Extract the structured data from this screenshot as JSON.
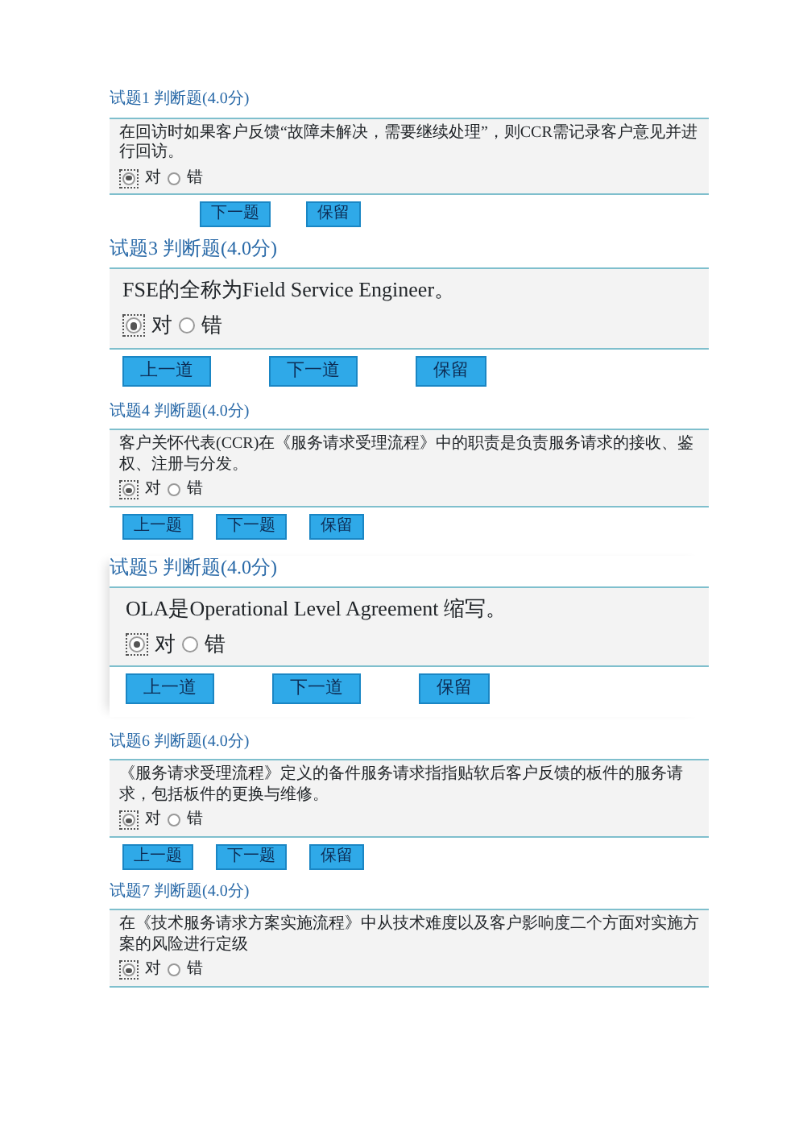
{
  "questions": [
    {
      "title": "试题1 判断题(4.0分)",
      "text": "在回访时如果客户反馈“故障未解决，需要继续处理”，则CCR需记录客户意见并进行回访。",
      "options": [
        {
          "label": "对",
          "selected": true
        },
        {
          "label": "错",
          "selected": false
        }
      ],
      "buttons": [
        "下一题",
        "保留"
      ]
    },
    {
      "title": "试题3 判断题(4.0分)",
      "text": "FSE的全称为Field Service Engineer。",
      "options": [
        {
          "label": "对",
          "selected": true
        },
        {
          "label": "错",
          "selected": false
        }
      ],
      "buttons": [
        "上一道",
        "下一道",
        "保留"
      ]
    },
    {
      "title": "试题4 判断题(4.0分)",
      "text": "客户关怀代表(CCR)在《服务请求受理流程》中的职责是负责服务请求的接收、鉴权、注册与分发。",
      "options": [
        {
          "label": "对",
          "selected": true
        },
        {
          "label": "错",
          "selected": false
        }
      ],
      "buttons": [
        "上一题",
        "下一题",
        "保留"
      ]
    },
    {
      "title": "试题5 判断题(4.0分)",
      "text": "OLA是Operational Level Agreement 缩写。",
      "options": [
        {
          "label": "对",
          "selected": true
        },
        {
          "label": "错",
          "selected": false
        }
      ],
      "buttons": [
        "上一道",
        "下一道",
        "保留"
      ]
    },
    {
      "title": "试题6 判断题(4.0分)",
      "text": "《服务请求受理流程》定义的备件服务请求指指贴软后客户反馈的板件的服务请求，包括板件的更换与维修。",
      "options": [
        {
          "label": "对",
          "selected": true
        },
        {
          "label": "错",
          "selected": false
        }
      ],
      "buttons": [
        "上一题",
        "下一题",
        "保留"
      ]
    },
    {
      "title": "试题7 判断题(4.0分)",
      "text": "在《技术服务请求方案实施流程》中从技术难度以及客户影响度二个方面对实施方案的风险进行定级",
      "options": [
        {
          "label": "对",
          "selected": true
        },
        {
          "label": "错",
          "selected": false
        }
      ]
    }
  ]
}
